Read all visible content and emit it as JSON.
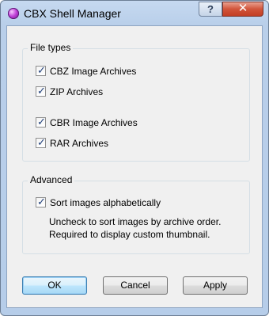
{
  "window": {
    "title": "CBX Shell Manager"
  },
  "titlebar": {
    "help_glyph": "?",
    "close_glyph": "✕"
  },
  "groups": {
    "file_types": {
      "label": "File types",
      "items": [
        {
          "label": "CBZ Image Archives",
          "checked": true
        },
        {
          "label": "ZIP Archives",
          "checked": true
        },
        {
          "label": "CBR Image Archives",
          "checked": true
        },
        {
          "label": "RAR Archives",
          "checked": true
        }
      ]
    },
    "advanced": {
      "label": "Advanced",
      "sort_label": "Sort images alphabetically",
      "sort_checked": true,
      "note_line1": "Uncheck to sort images by archive order.",
      "note_line2": "Required to display custom thumbnail."
    }
  },
  "buttons": {
    "ok": "OK",
    "cancel": "Cancel",
    "apply": "Apply"
  },
  "icons": {
    "app": "cbx-app-icon",
    "help": "help-icon",
    "close": "close-icon",
    "check": "checkmark-icon"
  },
  "check_glyph": "✓"
}
